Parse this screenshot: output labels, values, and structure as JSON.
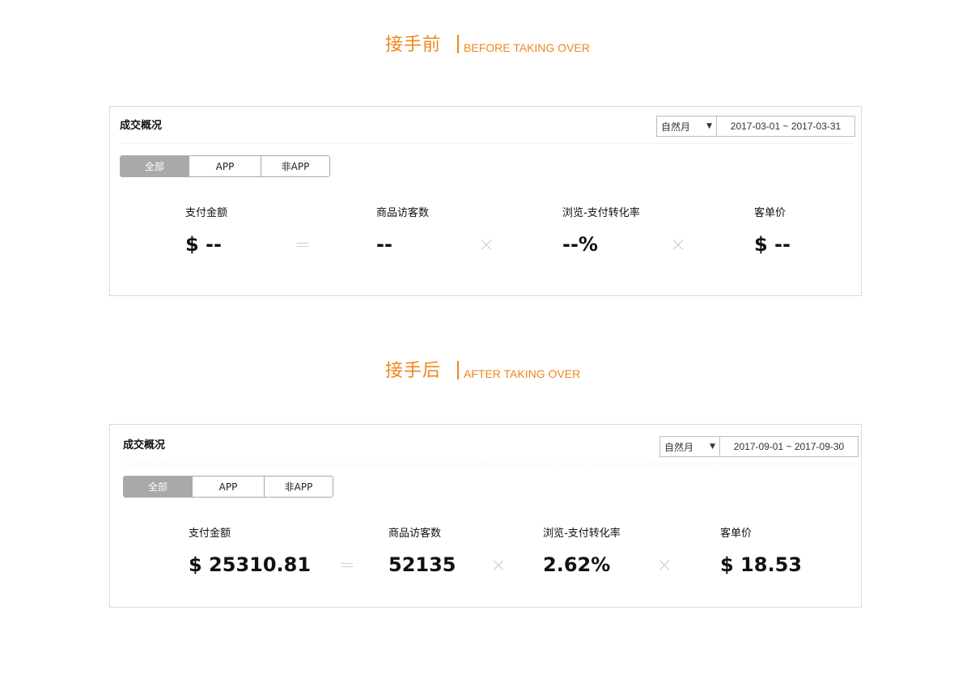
{
  "before": {
    "heading_cn": "接手前",
    "heading_en": "BEFORE TAKING OVER",
    "panel": {
      "title": "成交概况",
      "period": "自然月",
      "date_range": "2017-03-01 ~ 2017-03-31",
      "tabs": [
        {
          "label": "全部",
          "active": true
        },
        {
          "label": "APP",
          "active": false
        },
        {
          "label": "非APP",
          "active": false
        }
      ],
      "metrics": [
        {
          "label": "支付金额",
          "value": "$ --"
        },
        {
          "label": "商品访客数",
          "value": "--"
        },
        {
          "label": "浏览-支付转化率",
          "value": "--%"
        },
        {
          "label": "客单价",
          "value": "$ --"
        }
      ],
      "operators": [
        "=",
        "×",
        "×"
      ]
    }
  },
  "after": {
    "heading_cn": "接手后",
    "heading_en": "AFTER TAKING OVER",
    "panel": {
      "title": "成交概况",
      "period": "自然月",
      "date_range": "2017-09-01 ~ 2017-09-30",
      "tabs": [
        {
          "label": "全部",
          "active": true
        },
        {
          "label": "APP",
          "active": false
        },
        {
          "label": "非APP",
          "active": false
        }
      ],
      "metrics": [
        {
          "label": "支付金额",
          "value": "$ 25310.81"
        },
        {
          "label": "商品访客数",
          "value": "52135"
        },
        {
          "label": "浏览-支付转化率",
          "value": "2.62%"
        },
        {
          "label": "客单价",
          "value": "$ 18.53"
        }
      ],
      "operators": [
        "=",
        "×",
        "×"
      ]
    }
  },
  "colors": {
    "accent": "#f0861d",
    "active_tab": "#a9a9a9",
    "operator": "#cfcfcf"
  },
  "icons": {
    "period_caret": "caret-down-icon"
  }
}
